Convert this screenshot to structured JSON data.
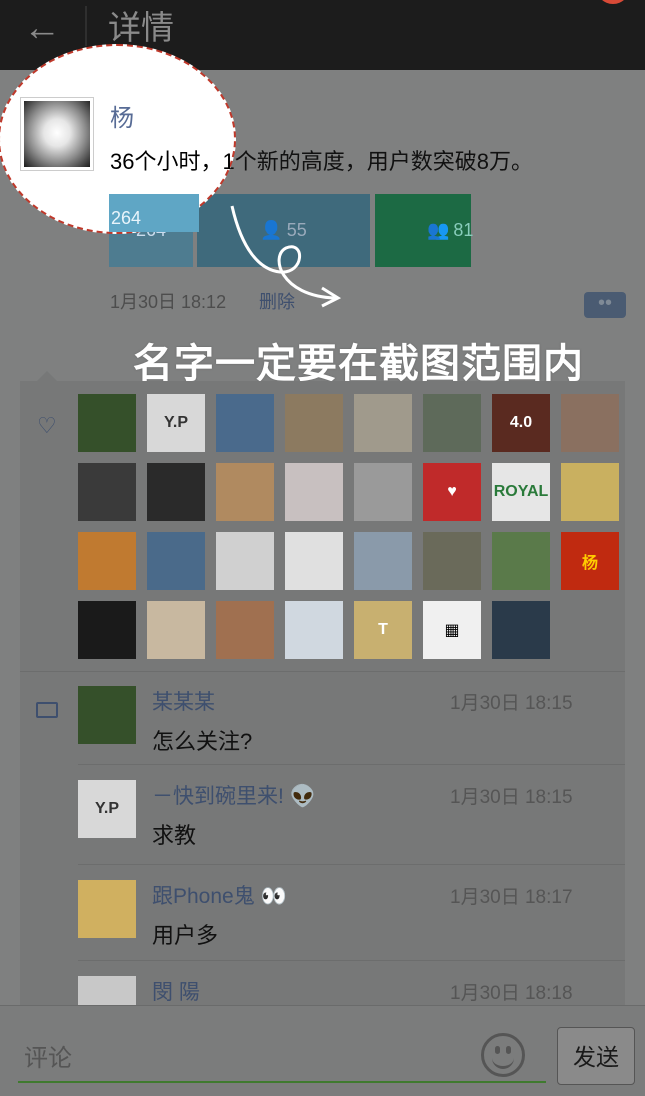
{
  "topbar": {
    "back_icon": "←",
    "title": "详情"
  },
  "post": {
    "author": "杨",
    "text": "36个小时，1个新的高度，用户数突破8万。",
    "tiles": [
      "264",
      "55",
      "81"
    ],
    "time": "1月30日 18:12",
    "delete_label": "删除",
    "more_icon": "••"
  },
  "annotation": {
    "text": "名字一定要在截图范围内"
  },
  "likes": {
    "icon": "♡",
    "rows": [
      [
        {
          "bg": "#35502a",
          "fg": "#88a",
          "label": ""
        },
        {
          "bg": "#d8d8d8",
          "fg": "#333",
          "label": "Y.P"
        },
        {
          "bg": "#4a6a8c",
          "fg": "#ccc",
          "label": ""
        },
        {
          "bg": "#8c7a60",
          "fg": "#ccc",
          "label": ""
        },
        {
          "bg": "#a09a8c",
          "fg": "#333",
          "label": ""
        },
        {
          "bg": "#5e6a5a",
          "fg": "#ccc",
          "label": ""
        },
        {
          "bg": "#5a2a20",
          "fg": "#fff",
          "label": "4.0"
        },
        {
          "bg": "#8a7060",
          "fg": "#ccc",
          "label": ""
        }
      ],
      [
        {
          "bg": "#3a3a3a",
          "fg": "#ccc",
          "label": ""
        },
        {
          "bg": "#2a2a2a",
          "fg": "#ccc",
          "label": ""
        },
        {
          "bg": "#b08a60",
          "fg": "#333",
          "label": ""
        },
        {
          "bg": "#c8c0c0",
          "fg": "#333",
          "label": ""
        },
        {
          "bg": "#9a9a9a",
          "fg": "#333",
          "label": ""
        },
        {
          "bg": "#c02a2a",
          "fg": "#fff",
          "label": "♥"
        },
        {
          "bg": "#e6e6e6",
          "fg": "#2a7a3a",
          "label": "ROYAL"
        },
        {
          "bg": "#c9b060",
          "fg": "#222",
          "label": ""
        }
      ],
      [
        {
          "bg": "#c07a30",
          "fg": "#fff",
          "label": ""
        },
        {
          "bg": "#4a6a8a",
          "fg": "#ccc",
          "label": ""
        },
        {
          "bg": "#d0d0d0",
          "fg": "#c02a2a",
          "label": ""
        },
        {
          "bg": "#e0e0e0",
          "fg": "#222",
          "label": ""
        },
        {
          "bg": "#8a9aaa",
          "fg": "#333",
          "label": ""
        },
        {
          "bg": "#6a6a5a",
          "fg": "#ccc",
          "label": ""
        },
        {
          "bg": "#5a7a4a",
          "fg": "#ccc",
          "label": ""
        },
        {
          "bg": "#c02a10",
          "fg": "#ffcc00",
          "label": "杨"
        }
      ],
      [
        {
          "bg": "#1a1a1a",
          "fg": "#aaa",
          "label": ""
        },
        {
          "bg": "#c8b8a0",
          "fg": "#333",
          "label": ""
        },
        {
          "bg": "#a07050",
          "fg": "#fff",
          "label": ""
        },
        {
          "bg": "#d0d8e0",
          "fg": "#333",
          "label": ""
        },
        {
          "bg": "#c8b070",
          "fg": "#fff",
          "label": "T"
        },
        {
          "bg": "#f0f0f0",
          "fg": "#000",
          "label": "▦"
        },
        {
          "bg": "#2a3a4a",
          "fg": "#ccc",
          "label": ""
        }
      ]
    ]
  },
  "comments": [
    {
      "name": "某某某",
      "time": "1月30日  18:15",
      "text": "怎么关注?",
      "avatar_bg": "#35502a",
      "avatar_fg": "#ccc",
      "avatar_label": ""
    },
    {
      "name": "－快到碗里来! 👽",
      "time": "1月30日  18:15",
      "text": "求教",
      "avatar_bg": "#d8d8d8",
      "avatar_fg": "#333",
      "avatar_label": "Y.P"
    },
    {
      "name": "跟Phone鬼 👀",
      "time": "1月30日  18:17",
      "text": "用户多",
      "avatar_bg": "#d0b060",
      "avatar_fg": "#333",
      "avatar_label": ""
    },
    {
      "name": "閔 陽",
      "time": "1月30日  18:18",
      "text": "",
      "avatar_bg": "#c8c8c8",
      "avatar_fg": "#333",
      "avatar_label": ""
    }
  ],
  "bottom": {
    "placeholder": "评论",
    "send_label": "发送",
    "emoji_icon": "smiley"
  }
}
